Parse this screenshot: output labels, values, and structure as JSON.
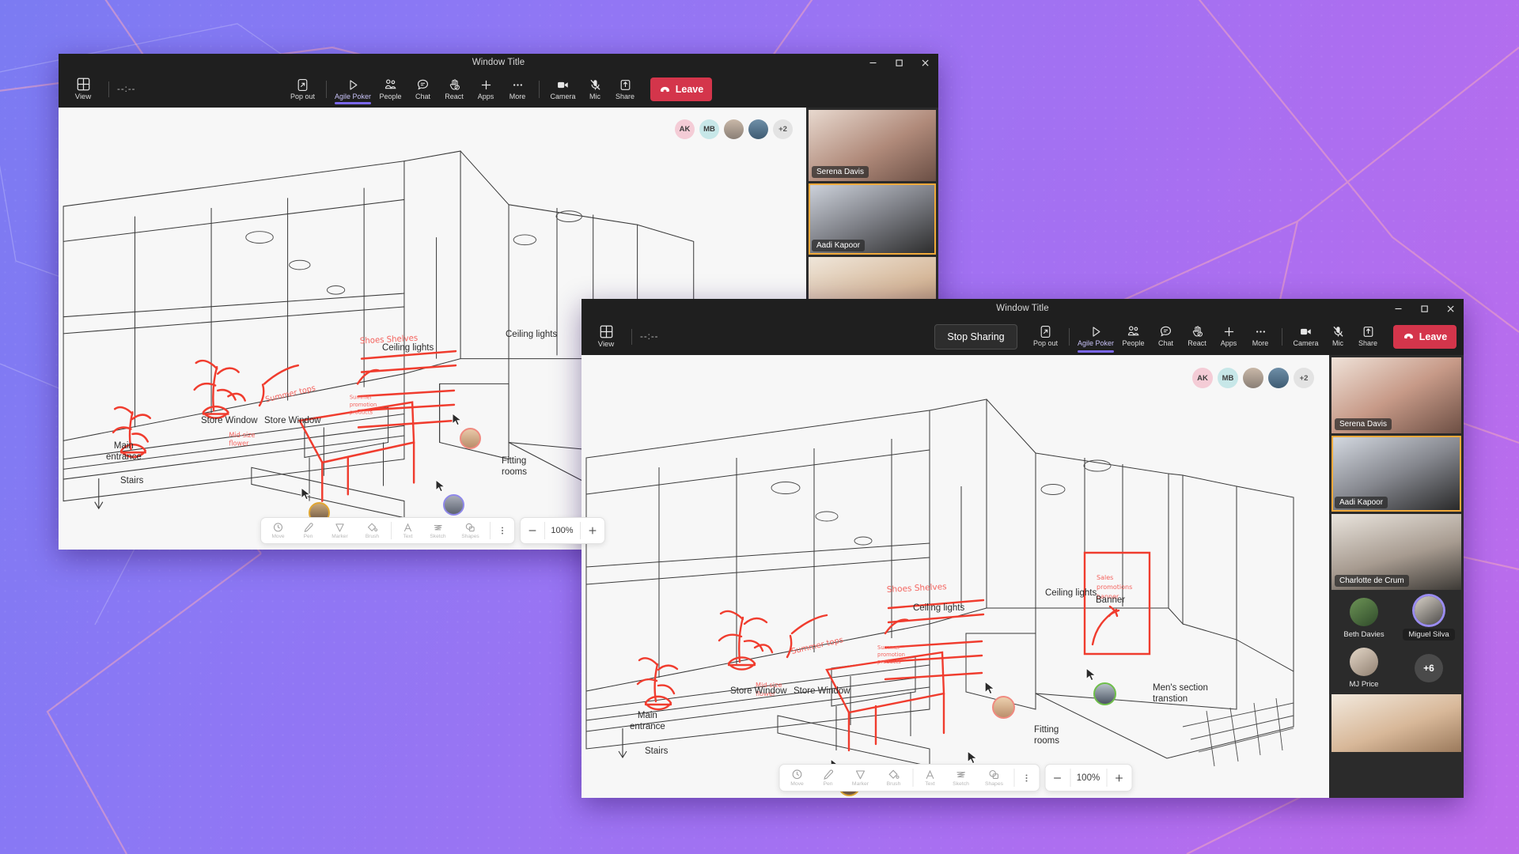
{
  "background": {
    "gradient_from": "#7b7bf2",
    "gradient_to": "#bd6ceb",
    "line_color": "#f0a0b8"
  },
  "windows": [
    {
      "id": "back",
      "title": "Window Title",
      "controls": {
        "minimize": "minimize-icon",
        "maximize": "maximize-icon",
        "close": "close-icon"
      },
      "toolbar": {
        "view_label": "View",
        "timer": "--:--",
        "stop_sharing": null,
        "items": [
          {
            "label": "Pop out",
            "icon": "pop-out-icon",
            "active": false
          },
          {
            "label": "Agile Poker",
            "icon": "play-icon",
            "active": true
          },
          {
            "label": "People",
            "icon": "people-icon",
            "active": false
          },
          {
            "label": "Chat",
            "icon": "chat-icon",
            "active": false
          },
          {
            "label": "React",
            "icon": "react-hand-icon",
            "active": false
          },
          {
            "label": "Apps",
            "icon": "plus-icon",
            "active": false
          },
          {
            "label": "More",
            "icon": "more-ellipsis-icon",
            "active": false
          },
          {
            "label": "Camera",
            "icon": "camera-icon",
            "active": false
          },
          {
            "label": "Mic",
            "icon": "mic-muted-icon",
            "active": false
          },
          {
            "label": "Share",
            "icon": "share-up-arrow-icon",
            "active": false
          }
        ],
        "leave_label": "Leave",
        "leave_color": "#d4354b"
      },
      "avatar_row": [
        {
          "initials": "AK",
          "color": "#f4ccd6",
          "type": "initials"
        },
        {
          "initials": "MB",
          "color": "#c7e7e8",
          "type": "initials"
        },
        {
          "initials": "",
          "color": "#9aa3b0",
          "type": "photo"
        },
        {
          "initials": "",
          "color": "#6f8fa8",
          "type": "photo"
        },
        {
          "initials": "+2",
          "color": "#e3e3e3",
          "type": "overflow"
        }
      ],
      "roster": [
        {
          "name": "Serena Davis",
          "selected": false,
          "bg": "#caa9a1"
        },
        {
          "name": "Aadi Kapoor",
          "selected": true,
          "bg": "#7d7f86"
        },
        {
          "name": "",
          "selected": false,
          "bg": "#d8c4ae"
        }
      ],
      "whiteboard": {
        "labels": [
          "Ceiling lights",
          "Ceiling lights",
          "Store Window",
          "Store Window",
          "Main\nentrance",
          "Stairs",
          "Fitting\nrooms"
        ],
        "annotations": [
          "Shoes Shelves",
          "Summer tops",
          "Summer promotion products",
          "Mid-size flower"
        ]
      },
      "wb_toolbar": {
        "tools": [
          {
            "label": "Move",
            "icon": "move-icon"
          },
          {
            "label": "Pen",
            "icon": "pen-icon"
          },
          {
            "label": "Marker",
            "icon": "marker-icon"
          },
          {
            "label": "Brush",
            "icon": "brush-bucket-icon"
          },
          {
            "label": "Text",
            "icon": "text-a-icon"
          },
          {
            "label": "Sketch",
            "icon": "sketch-squiggle-icon"
          },
          {
            "label": "Shapes",
            "icon": "shapes-icon"
          }
        ],
        "more": "more-vertical-icon",
        "zoom_out": "minus-icon",
        "zoom_level": "100%",
        "zoom_in": "plus-icon"
      }
    },
    {
      "id": "front",
      "title": "Window Title",
      "controls": {
        "minimize": "minimize-icon",
        "maximize": "maximize-icon",
        "close": "close-icon"
      },
      "toolbar": {
        "view_label": "View",
        "timer": "--:--",
        "stop_sharing": "Stop Sharing",
        "items": [
          {
            "label": "Pop out",
            "icon": "pop-out-icon",
            "active": false
          },
          {
            "label": "Agile Poker",
            "icon": "play-icon",
            "active": true
          },
          {
            "label": "People",
            "icon": "people-icon",
            "active": false
          },
          {
            "label": "Chat",
            "icon": "chat-icon",
            "active": false
          },
          {
            "label": "React",
            "icon": "react-hand-icon",
            "active": false
          },
          {
            "label": "Apps",
            "icon": "plus-icon",
            "active": false
          },
          {
            "label": "More",
            "icon": "more-ellipsis-icon",
            "active": false
          },
          {
            "label": "Camera",
            "icon": "camera-icon",
            "active": false
          },
          {
            "label": "Mic",
            "icon": "mic-muted-icon",
            "active": false
          },
          {
            "label": "Share",
            "icon": "share-up-arrow-icon",
            "active": false
          }
        ],
        "leave_label": "Leave",
        "leave_color": "#d4354b"
      },
      "avatar_row": [
        {
          "initials": "AK",
          "color": "#f4ccd6",
          "type": "initials"
        },
        {
          "initials": "MB",
          "color": "#c7e7e8",
          "type": "initials"
        },
        {
          "initials": "",
          "color": "#9aa3b0",
          "type": "photo"
        },
        {
          "initials": "",
          "color": "#6f8fa8",
          "type": "photo"
        },
        {
          "initials": "+2",
          "color": "#e3e3e3",
          "type": "overflow"
        }
      ],
      "roster": [
        {
          "name": "Serena Davis",
          "selected": false,
          "bg": "#caa9a1"
        },
        {
          "name": "Aadi Kapoor",
          "selected": true,
          "bg": "#7d7f86"
        },
        {
          "name": "Charlotte de Crum",
          "selected": false,
          "bg": "#b9b2aa"
        }
      ],
      "roster_grid": [
        {
          "name": "Beth Davies",
          "speaking": false,
          "badge": false,
          "bg": "#5d7a52"
        },
        {
          "name": "Miguel Silva",
          "speaking": true,
          "badge": true,
          "bg": "#8d8d96"
        },
        {
          "name": "MJ Price",
          "speaking": false,
          "badge": false,
          "bg": "#c0b6ac"
        },
        {
          "name": "+6",
          "speaking": false,
          "badge": false,
          "overflow": true
        }
      ],
      "roster_last": {
        "name": "",
        "bg": "#d8c4ae"
      },
      "whiteboard": {
        "labels": [
          "Ceiling lights",
          "Ceiling lights",
          "Banner",
          "Store Window",
          "Store Window",
          "Main\nentrance",
          "Stairs",
          "Men's section\ntranstion",
          "Fitting\nrooms"
        ],
        "annotations": [
          "Shoes Shelves",
          "Summer tops",
          "Summer promotion products",
          "Mid-size flower",
          "Sales promotions banner"
        ]
      },
      "wb_toolbar": {
        "tools": [
          {
            "label": "Move",
            "icon": "move-icon"
          },
          {
            "label": "Pen",
            "icon": "pen-icon"
          },
          {
            "label": "Marker",
            "icon": "marker-icon"
          },
          {
            "label": "Brush",
            "icon": "brush-bucket-icon"
          },
          {
            "label": "Text",
            "icon": "text-a-icon"
          },
          {
            "label": "Sketch",
            "icon": "sketch-squiggle-icon"
          },
          {
            "label": "Shapes",
            "icon": "shapes-icon"
          }
        ],
        "more": "more-vertical-icon",
        "zoom_out": "minus-icon",
        "zoom_level": "100%",
        "zoom_in": "plus-icon"
      }
    }
  ]
}
